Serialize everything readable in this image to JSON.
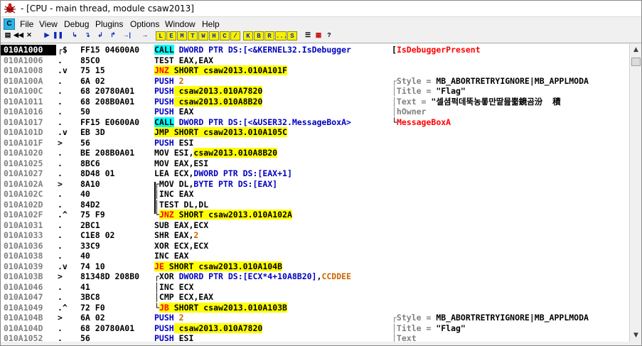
{
  "window": {
    "title": "- [CPU - main thread, module csaw2013]"
  },
  "menu": {
    "c_label": "C",
    "items": [
      "File",
      "View",
      "Debug",
      "Plugins",
      "Options",
      "Window",
      "Help"
    ]
  },
  "toolbar": {
    "left": [
      "▤",
      "◀◀",
      "✕",
      "▶",
      "❚❚",
      "↳",
      "↴",
      "↲",
      "↱",
      "→|"
    ],
    "windows": [
      "L",
      "E",
      "M",
      "T",
      "W",
      "H",
      "C",
      "/",
      "K",
      "B",
      "R",
      "...",
      "S"
    ],
    "right": [
      "☰",
      "▦",
      "?"
    ]
  },
  "rows": [
    {
      "addr": "010A1000",
      "mark": "┌$",
      "hex": "FF15 04600A0",
      "dis": [
        {
          "t": "CALL",
          "c": "kw-call"
        },
        {
          "t": " DWORD PTR DS:[<&KERNEL32.IsDebugger",
          "c": "blue"
        }
      ],
      "cmt": [
        {
          "t": "[",
          "c": ""
        },
        {
          "t": "IsDebuggerPresent",
          "c": "red"
        }
      ],
      "sel": true
    },
    {
      "addr": "010A1006",
      "mark": ".",
      "hex": "85C0",
      "dis": [
        {
          "t": "TEST EAX,EAX",
          "c": ""
        }
      ],
      "cmt": []
    },
    {
      "addr": "010A1008",
      "mark": ".v",
      "hex": "75 15",
      "dis": [
        {
          "t": "JNZ",
          "c": "kw-jcc"
        },
        {
          "t": " SHORT csaw2013.010A101F",
          "c": "lbl"
        }
      ],
      "cmt": []
    },
    {
      "addr": "010A100A",
      "mark": ".",
      "hex": "6A 02",
      "dis": [
        {
          "t": "PUSH",
          "c": "blue"
        },
        {
          "t": " 2",
          "c": "im"
        }
      ],
      "cmt": [
        {
          "t": "┌Style = ",
          "c": "gray"
        },
        {
          "t": "MB_ABORTRETRYIGNORE|MB_APPLMODA",
          "c": ""
        }
      ]
    },
    {
      "addr": "010A100C",
      "mark": ".",
      "hex": "68 20780A01",
      "dis": [
        {
          "t": "PUSH",
          "c": "blue"
        },
        {
          "t": " csaw2013.010A7820",
          "c": "lbl"
        }
      ],
      "cmt": [
        {
          "t": "│Title = ",
          "c": "gray"
        },
        {
          "t": "\"Flag\"",
          "c": ""
        }
      ]
    },
    {
      "addr": "010A1011",
      "mark": ".",
      "hex": "68 208B0A01",
      "dis": [
        {
          "t": "PUSH",
          "c": "blue"
        },
        {
          "t": " csaw2013.010A8B20",
          "c": "lbl"
        }
      ],
      "cmt": [
        {
          "t": "│Text = ",
          "c": "gray"
        },
        {
          "t": "\"셀셤퍽데뚝농롷만땉믎뿗鏡곰汾  積",
          "c": ""
        }
      ]
    },
    {
      "addr": "010A1016",
      "mark": ".",
      "hex": "50",
      "dis": [
        {
          "t": "PUSH",
          "c": "blue"
        },
        {
          "t": " EAX",
          "c": ""
        }
      ],
      "cmt": [
        {
          "t": "│hOwner",
          "c": "gray"
        }
      ]
    },
    {
      "addr": "010A1017",
      "mark": ".",
      "hex": "FF15 E0600A0",
      "dis": [
        {
          "t": "CALL",
          "c": "kw-call"
        },
        {
          "t": " DWORD PTR DS:[<&USER32.MessageBoxA>",
          "c": "blue"
        }
      ],
      "cmt": [
        {
          "t": "└",
          "c": ""
        },
        {
          "t": "MessageBoxA",
          "c": "red"
        }
      ]
    },
    {
      "addr": "010A101D",
      "mark": ".v",
      "hex": "EB 3D",
      "dis": [
        {
          "t": "JMP",
          "c": "kw-jmp"
        },
        {
          "t": " SHORT csaw2013.010A105C",
          "c": "lbl"
        }
      ],
      "cmt": []
    },
    {
      "addr": "010A101F",
      "mark": ">",
      "hex": "56",
      "dis": [
        {
          "t": "PUSH",
          "c": "blue"
        },
        {
          "t": " ESI",
          "c": ""
        }
      ],
      "cmt": []
    },
    {
      "addr": "010A1020",
      "mark": ".",
      "hex": "BE 208B0A01",
      "dis": [
        {
          "t": "MOV ESI,",
          "c": ""
        },
        {
          "t": "csaw2013.010A8B20",
          "c": "lbl"
        }
      ],
      "cmt": []
    },
    {
      "addr": "010A1025",
      "mark": ".",
      "hex": "8BC6",
      "dis": [
        {
          "t": "MOV EAX,ESI",
          "c": ""
        }
      ],
      "cmt": []
    },
    {
      "addr": "010A1027",
      "mark": ".",
      "hex": "8D48 01",
      "dis": [
        {
          "t": "LEA ECX,",
          "c": ""
        },
        {
          "t": "DWORD PTR DS:[EAX+1]",
          "c": "blue"
        }
      ],
      "cmt": []
    },
    {
      "addr": "010A102A",
      "mark": ">",
      "hex": "8A10",
      "dis": [
        {
          "t": "┌MOV DL,",
          "c": ""
        },
        {
          "t": "BYTE PTR DS:[EAX]",
          "c": "blue"
        }
      ],
      "cmt": []
    },
    {
      "addr": "010A102C",
      "mark": ".",
      "hex": "40",
      "dis": [
        {
          "t": "│INC EAX",
          "c": ""
        }
      ],
      "cmt": []
    },
    {
      "addr": "010A102D",
      "mark": ".",
      "hex": "84D2",
      "dis": [
        {
          "t": "│TEST DL,DL",
          "c": ""
        }
      ],
      "cmt": []
    },
    {
      "addr": "010A102F",
      "mark": ".^",
      "hex": "75 F9",
      "dis": [
        {
          "t": "└",
          "c": ""
        },
        {
          "t": "JNZ",
          "c": "kw-jcc"
        },
        {
          "t": " SHORT csaw2013.010A102A",
          "c": "lbl"
        }
      ],
      "cmt": []
    },
    {
      "addr": "010A1031",
      "mark": ".",
      "hex": "2BC1",
      "dis": [
        {
          "t": "SUB EAX,ECX",
          "c": ""
        }
      ],
      "cmt": []
    },
    {
      "addr": "010A1033",
      "mark": ".",
      "hex": "C1E8 02",
      "dis": [
        {
          "t": "SHR EAX,",
          "c": ""
        },
        {
          "t": "2",
          "c": "im"
        }
      ],
      "cmt": []
    },
    {
      "addr": "010A1036",
      "mark": ".",
      "hex": "33C9",
      "dis": [
        {
          "t": "XOR ECX,ECX",
          "c": ""
        }
      ],
      "cmt": []
    },
    {
      "addr": "010A1038",
      "mark": ".",
      "hex": "40",
      "dis": [
        {
          "t": "INC EAX",
          "c": ""
        }
      ],
      "cmt": []
    },
    {
      "addr": "010A1039",
      "mark": ".v",
      "hex": "74 10",
      "dis": [
        {
          "t": "JE",
          "c": "kw-jcc"
        },
        {
          "t": " SHORT csaw2013.010A104B",
          "c": "lbl"
        }
      ],
      "cmt": []
    },
    {
      "addr": "010A103B",
      "mark": ">",
      "hex": "81348D 208B0",
      "dis": [
        {
          "t": "┌XOR ",
          "c": ""
        },
        {
          "t": "DWORD PTR DS:[ECX*4+10A8B20]",
          "c": "blue"
        },
        {
          "t": ",",
          "c": ""
        },
        {
          "t": "CCDDEE",
          "c": "im"
        }
      ],
      "cmt": []
    },
    {
      "addr": "010A1046",
      "mark": ".",
      "hex": "41",
      "dis": [
        {
          "t": "│INC ECX",
          "c": ""
        }
      ],
      "cmt": []
    },
    {
      "addr": "010A1047",
      "mark": ".",
      "hex": "3BC8",
      "dis": [
        {
          "t": "│CMP ECX,EAX",
          "c": ""
        }
      ],
      "cmt": []
    },
    {
      "addr": "010A1049",
      "mark": ".^",
      "hex": "72 F0",
      "dis": [
        {
          "t": "└",
          "c": ""
        },
        {
          "t": "JB",
          "c": "kw-jcc"
        },
        {
          "t": " SHORT csaw2013.010A103B",
          "c": "lbl"
        }
      ],
      "cmt": []
    },
    {
      "addr": "010A104B",
      "mark": ">",
      "hex": "6A 02",
      "dis": [
        {
          "t": "PUSH",
          "c": "blue"
        },
        {
          "t": " 2",
          "c": "im"
        }
      ],
      "cmt": [
        {
          "t": "┌Style = ",
          "c": "gray"
        },
        {
          "t": "MB_ABORTRETRYIGNORE|MB_APPLMODA",
          "c": ""
        }
      ]
    },
    {
      "addr": "010A104D",
      "mark": ".",
      "hex": "68 20780A01",
      "dis": [
        {
          "t": "PUSH",
          "c": "blue"
        },
        {
          "t": " csaw2013.010A7820",
          "c": "lbl"
        }
      ],
      "cmt": [
        {
          "t": "│Title = ",
          "c": "gray"
        },
        {
          "t": "\"Flag\"",
          "c": ""
        }
      ]
    },
    {
      "addr": "010A1052",
      "mark": ".",
      "hex": "56",
      "dis": [
        {
          "t": "PUSH",
          "c": "blue"
        },
        {
          "t": " ESI",
          "c": ""
        }
      ],
      "cmt": [
        {
          "t": "│Text",
          "c": "gray"
        }
      ]
    }
  ]
}
